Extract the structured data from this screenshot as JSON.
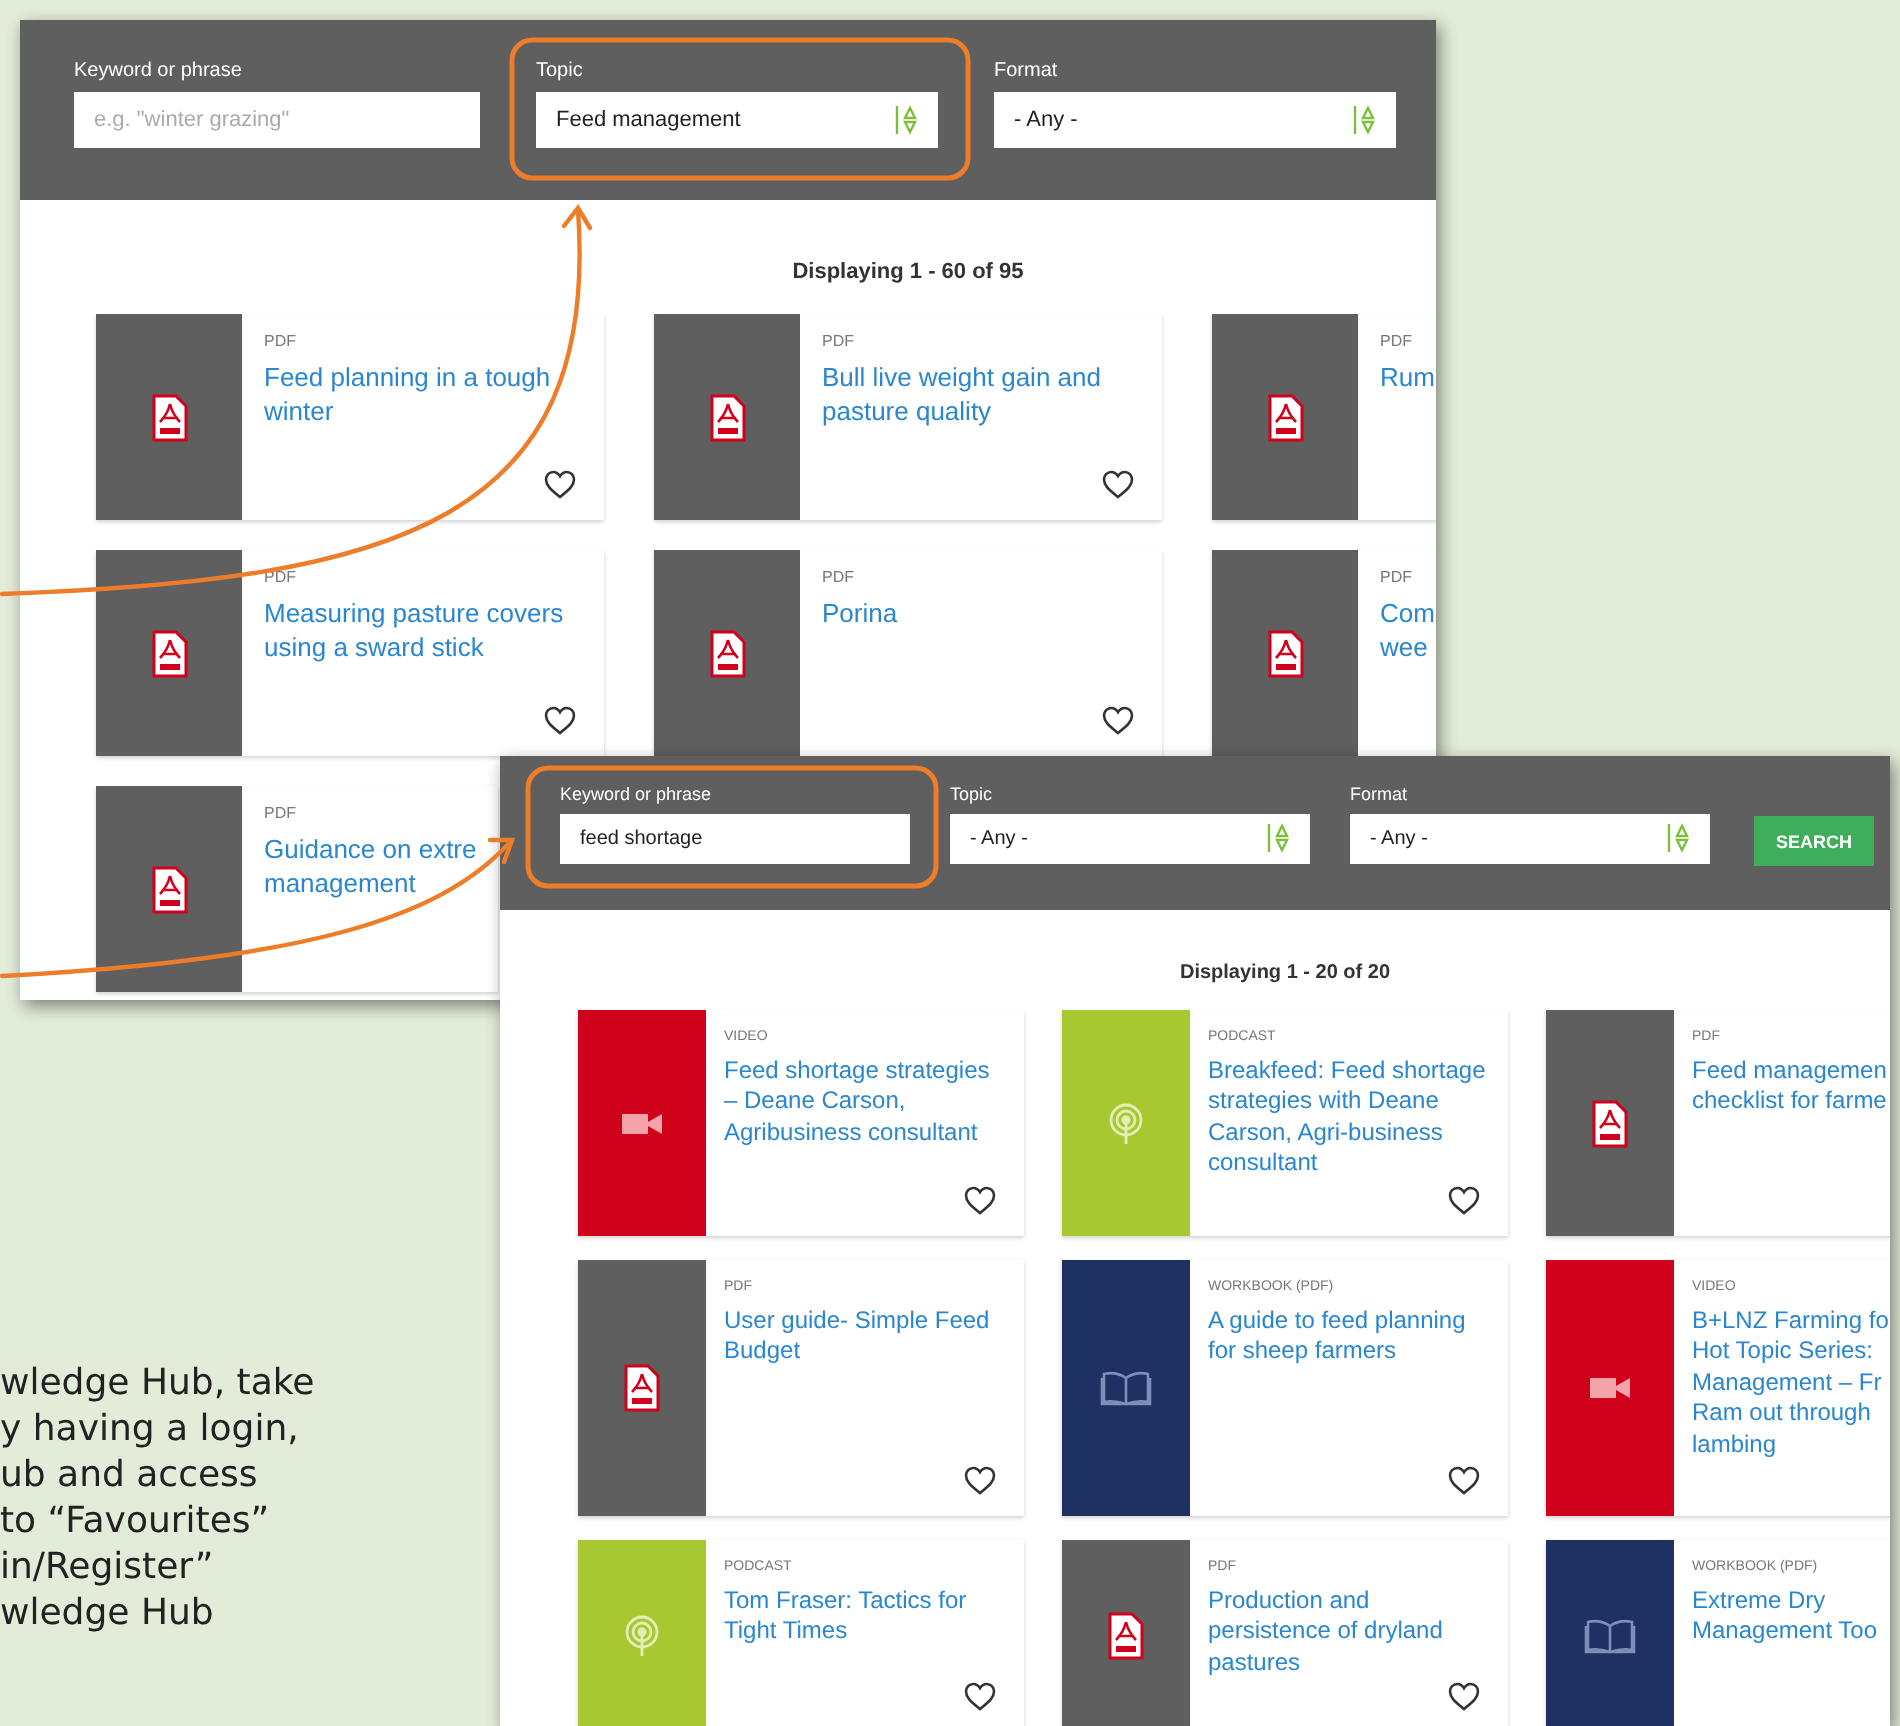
{
  "note": "wledge Hub, take\ny having a login,\nub and access\nto “Favourites”\nin/Register”\nwledge Hub",
  "screenshots": [
    {
      "fields": [
        {
          "kind": "text",
          "label": "Keyword or phrase",
          "placeholder": "e.g. \"winter grazing\""
        },
        {
          "kind": "select",
          "label": "Topic",
          "value": "Feed management"
        },
        {
          "kind": "select",
          "label": "Format",
          "value": "- Any -"
        }
      ],
      "count": "Displaying 1 - 60 of 95",
      "cards": [
        {
          "kind": "pdf",
          "type": "PDF",
          "title": "Feed planning in a tough winter",
          "heart": true
        },
        {
          "kind": "pdf",
          "type": "PDF",
          "title": "Bull live weight gain and pasture quality",
          "heart": true
        },
        {
          "kind": "pdf",
          "type": "PDF",
          "title": "Rum",
          "heart": false
        },
        {
          "kind": "pdf",
          "type": "PDF",
          "title": "Measuring pasture covers using a sward stick",
          "heart": true
        },
        {
          "kind": "pdf",
          "type": "PDF",
          "title": "Porina",
          "heart": true
        },
        {
          "kind": "pdf",
          "type": "PDF",
          "title": "Com\nwee",
          "heart": false
        },
        {
          "kind": "pdf",
          "type": "PDF",
          "title": "Guidance on extre\nmanagement",
          "heart": false
        }
      ]
    },
    {
      "fields": [
        {
          "kind": "text",
          "label": "Keyword or phrase",
          "value": "feed shortage"
        },
        {
          "kind": "select",
          "label": "Topic",
          "value": "- Any -"
        },
        {
          "kind": "select",
          "label": "Format",
          "value": "- Any -"
        }
      ],
      "search_button": "SEARCH",
      "count": "Displaying 1 - 20 of 20",
      "cards": [
        {
          "kind": "video",
          "type": "VIDEO",
          "title": "Feed shortage strategies – Deane Carson, Agribusiness consultant",
          "heart": true
        },
        {
          "kind": "podcast",
          "type": "PODCAST",
          "title": "Breakfeed: Feed shortage strategies with Deane Carson, Agri-business consultant",
          "heart": true
        },
        {
          "kind": "pdf",
          "type": "PDF",
          "title": "Feed managemen\nchecklist for farme",
          "heart": false
        },
        {
          "kind": "pdf",
          "type": "PDF",
          "title": "User guide- Simple Feed Budget",
          "heart": true
        },
        {
          "kind": "workbook",
          "type": "WORKBOOK (PDF)",
          "title": "A guide to feed planning for sheep farmers",
          "heart": true
        },
        {
          "kind": "video",
          "type": "VIDEO",
          "title": "B+LNZ Farming fo\nHot Topic Series:\nManagement – Fr\nRam out through\nlambing",
          "heart": false
        },
        {
          "kind": "podcast",
          "type": "PODCAST",
          "title": "Tom Fraser: Tactics for Tight Times",
          "heart": true
        },
        {
          "kind": "pdf",
          "type": "PDF",
          "title": "Production and persistence of dryland pastures",
          "heart": true
        },
        {
          "kind": "workbook",
          "type": "WORKBOOK (PDF)",
          "title": "Extreme Dry\nManagement Too",
          "heart": false
        }
      ]
    }
  ]
}
